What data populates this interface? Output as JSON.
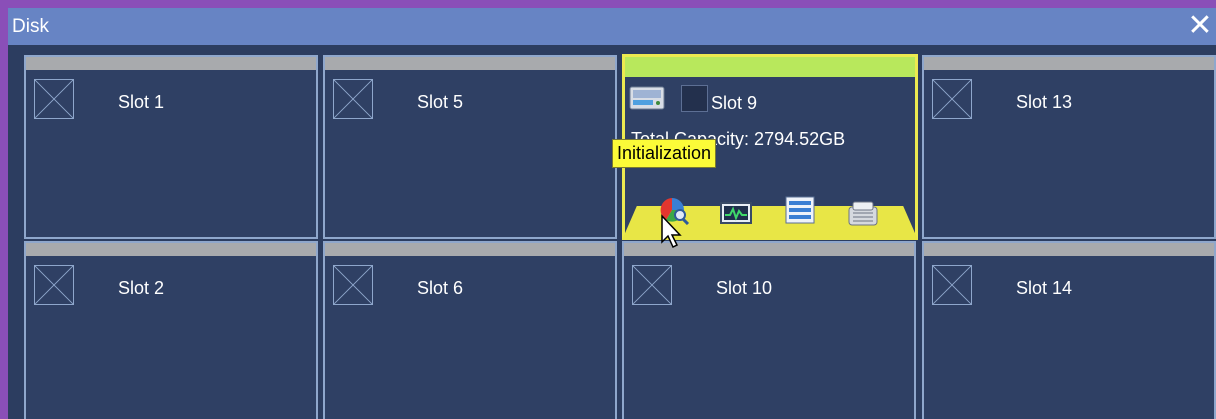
{
  "window": {
    "title": "Disk",
    "close_label": "✕"
  },
  "slots": {
    "s1": {
      "label": "Slot 1"
    },
    "s5": {
      "label": "Slot 5"
    },
    "s9": {
      "label": "Slot 9",
      "capacity": "Total  Capacity: 2794.52GB",
      "selected": false
    },
    "s13": {
      "label": "Slot 13"
    },
    "s2": {
      "label": "Slot 2"
    },
    "s6": {
      "label": "Slot 6"
    },
    "s10": {
      "label": "Slot 10"
    },
    "s14": {
      "label": "Slot 14"
    }
  },
  "tooltip": {
    "text": "Initialization"
  },
  "actions": [
    "initialization-icon",
    "monitor-icon",
    "info-list-icon",
    "format-icon"
  ],
  "colors": {
    "titlebar": "#6784c4",
    "panel": "#2f4064",
    "slot_border": "#8fa7cc",
    "active_border": "#ecea50",
    "active_bar": "#b8e85c",
    "tooltip_bg": "#fbfb38"
  }
}
